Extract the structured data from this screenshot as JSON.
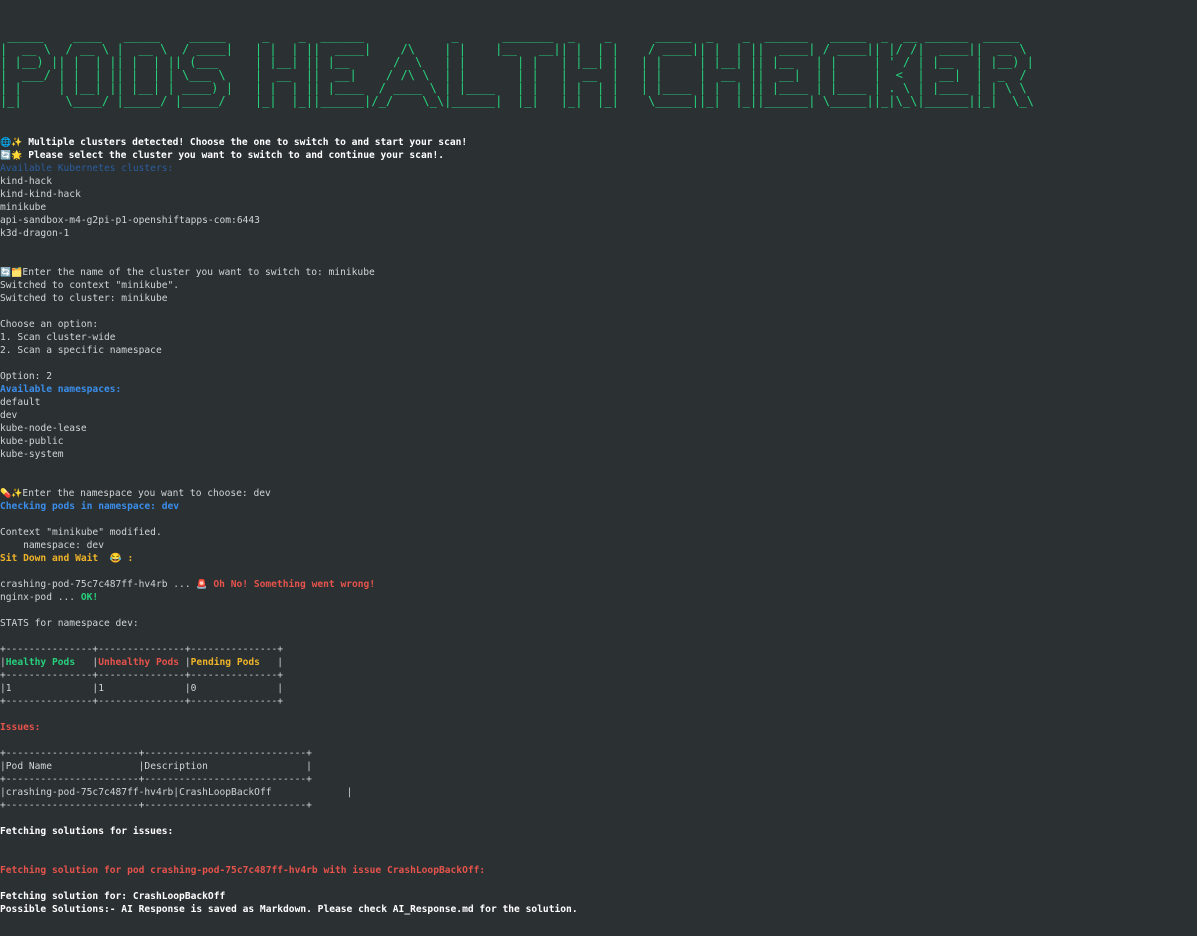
{
  "banner": {
    "ascii_art": " _____    ____   _____    _____     _    _  ______            _      _______  _    _      _____  _    _  ______   _____  _  __ ______  _____  \n|  __ \\  / __ \\ |  __ \\  / ____|   | |  | ||  ____|    /\\    | |    |__   __|| |  | |    / ____|| |  | ||  ____| / ____|| |/ /|  ____||  __ \\ \n| |__) || |  | || |  | || (___     | |__| || |__      /  \\   | |       | |   | |__| |   | |     | |__| || |__   | |     | ' / | |__   | |__) |\n|  ___/ | |  | || |  | | \\___ \\    |  __  ||  __|    / /\\ \\  | |       | |   |  __  |   | |     |  __  ||  __|  | |     |  <  |  __|  |  _  / \n| |     | |__| || |__| | ____) |   | |  | || |____  / ____ \\ | |____   | |   | |  | |   | |____ | |  | || |____ | |____ | . \\ | |____ | | \\ \\ \n|_|      \\____/ |_____/ |_____/    |_|  |_||______|/_/    \\_\\|______|  |_|   |_|  |_|    \\_____||_|  |_||______| \\_____||_|\\_\\|______||_|  \\_\\",
    "text": "PODS HEALTH CHECKER"
  },
  "intro": {
    "emoji1": "🌐✨",
    "multiple_clusters": " Multiple clusters detected! Choose the one to switch to and start your scan!",
    "emoji2": "🔄🌟",
    "select_cluster": " Please select the cluster you want to switch to and continue your scan!.",
    "available_clusters_label": "Available Kubernetes clusters:"
  },
  "clusters": [
    "kind-hack",
    "kind-kind-hack",
    "minikube",
    "api-sandbox-m4-g2pi-p1-openshiftapps-com:6443",
    "k3d-dragon-1"
  ],
  "switch": {
    "emoji": "🔄🗂️",
    "prompt": "Enter the name of the cluster you want to switch to: minikube",
    "context_msg": "Switched to context \"minikube\".",
    "cluster_msg": "Switched to cluster: minikube"
  },
  "options": {
    "header": "Choose an option:",
    "opt1": "1. Scan cluster-wide",
    "opt2": "2. Scan a specific namespace",
    "chosen": "Option: 2",
    "available_ns_label": "Available namespaces:"
  },
  "namespaces": [
    "default",
    "dev",
    "kube-node-lease",
    "kube-public",
    "kube-system"
  ],
  "ns_select": {
    "emoji": "💊✨",
    "prompt": "Enter the namespace you want to choose: dev",
    "checking": "Checking pods in namespace: dev",
    "context_modified": "Context \"minikube\" modified.",
    "ns_line": "    namespace: dev",
    "wait": "Sit Down and Wait  😂 :"
  },
  "pods": [
    {
      "name": "crashing-pod-75c7c487ff-hv4rb ... ",
      "emoji": "🚨",
      "status": " Oh No! Something went wrong!",
      "ok": false
    },
    {
      "name": "nginx-pod ... ",
      "emoji": "",
      "status": "OK!",
      "ok": true
    }
  ],
  "stats": {
    "title": "STATS for namespace dev:",
    "border": "+---------------+---------------+---------------+",
    "headers": [
      "Healthy Pods",
      "Unhealthy Pods",
      "Pending Pods"
    ],
    "values": [
      "1",
      "1",
      "0"
    ]
  },
  "issues": {
    "label": "Issues:",
    "border": "+-----------------------+----------------------------+",
    "col_pod": "Pod Name",
    "col_desc": "Description",
    "row_pod": "crashing-pod-75c7c487ff-hv4rb",
    "row_desc": "CrashLoopBackOff"
  },
  "solutions": {
    "fetching_issues": "Fetching solutions for issues:",
    "fetching_pod": "Fetching solution for pod crashing-pod-75c7c487ff-hv4rb with issue CrashLoopBackOff:",
    "fetching_for": "Fetching solution for: CrashLoopBackOff",
    "possible": "Possible Solutions:- AI Response is saved as Markdown. Please check AI_Response.md for the solution."
  }
}
